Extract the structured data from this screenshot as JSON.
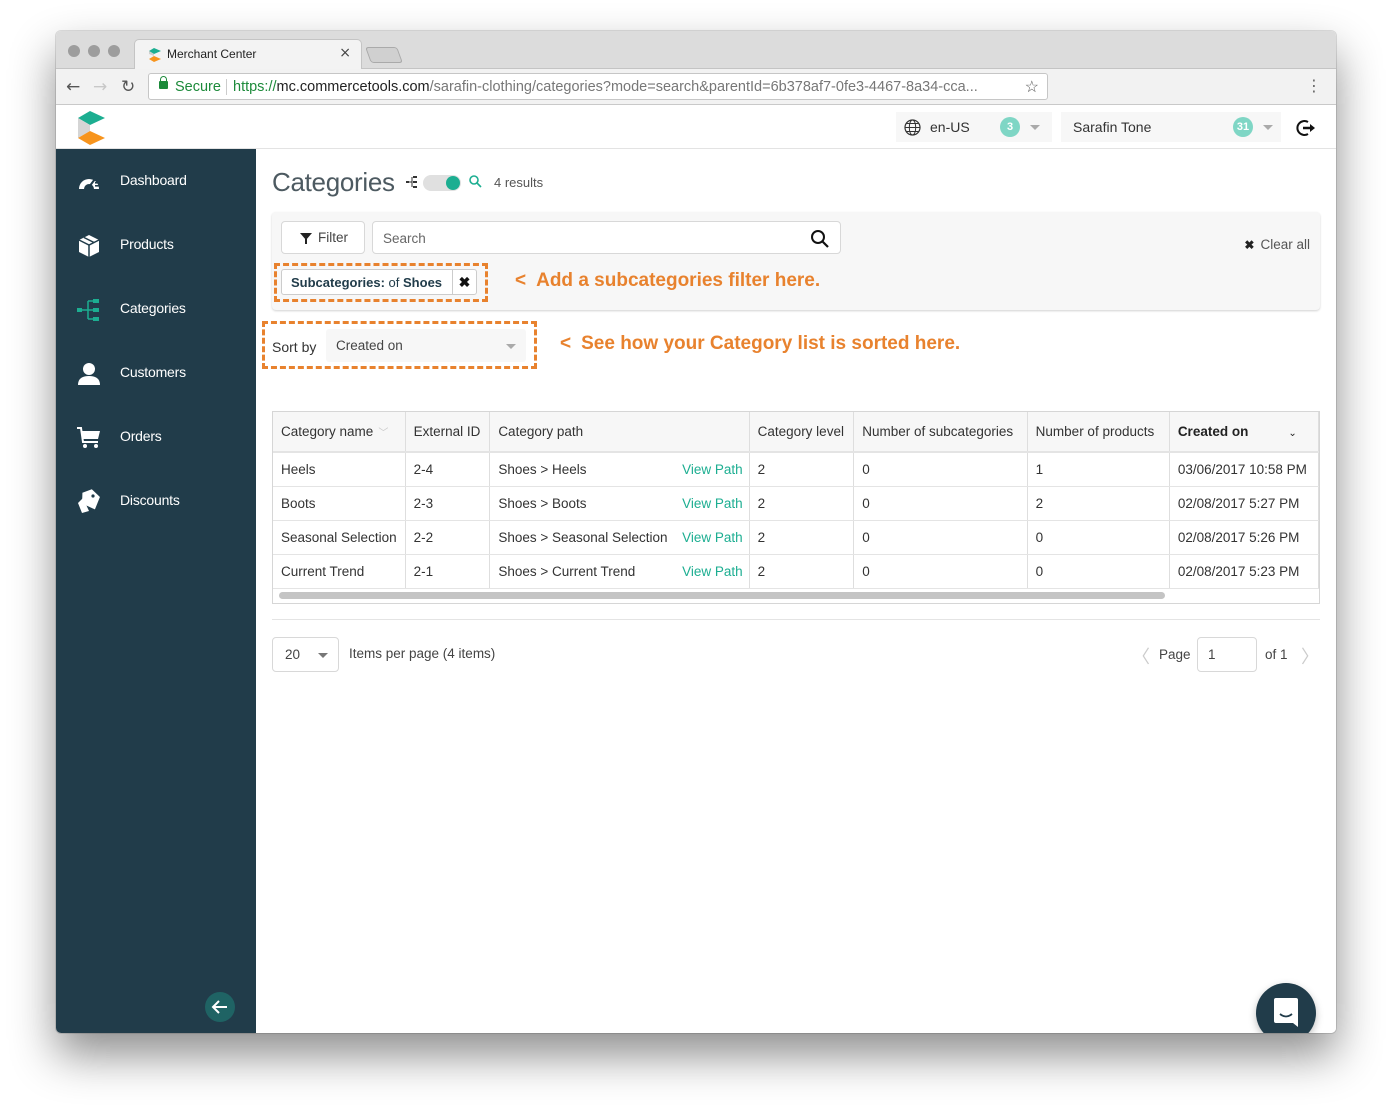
{
  "browser": {
    "tab_title": "Merchant Center",
    "secure_label": "Secure",
    "url_scheme": "https://",
    "url_host": "mc.commercetools.com",
    "url_path": "/sarafin-clothing/categories?mode=search&parentId=6b378af7-0fe3-4467-8a34-cca..."
  },
  "header": {
    "locale": "en-US",
    "locale_badge": "3",
    "user_name": "Sarafin Tone",
    "user_badge": "31",
    "badge_color": "#7fd6c5"
  },
  "sidebar": {
    "items": [
      {
        "label": "Dashboard",
        "icon": "dashboard-icon",
        "active": false
      },
      {
        "label": "Products",
        "icon": "box-icon",
        "active": false
      },
      {
        "label": "Categories",
        "icon": "category-tree-icon",
        "active": true
      },
      {
        "label": "Customers",
        "icon": "user-icon",
        "active": false
      },
      {
        "label": "Orders",
        "icon": "cart-icon",
        "active": false
      },
      {
        "label": "Discounts",
        "icon": "tag-icon",
        "active": false
      }
    ],
    "bg_color": "#213c4a",
    "accent_color": "#1cae91"
  },
  "page": {
    "title": "Categories",
    "results": "4 results",
    "filter_label": "Filter",
    "search_placeholder": "Search",
    "clear_all": "Clear all",
    "chip_key": "Subcategories:",
    "chip_mid": "of",
    "chip_value": "Shoes",
    "annotation_filter": "Add a subcategories filter here.",
    "annotation_sort": "See how your Category list is sorted here.",
    "annotation_marker": "<",
    "annotation_color": "#e8822e",
    "sort_label": "Sort by",
    "sort_value": "Created on"
  },
  "table": {
    "columns": [
      "Category name",
      "External ID",
      "Category path",
      "Category level",
      "Number of subcategories",
      "Number of products",
      "Created on"
    ],
    "view_path_label": "View Path",
    "rows": [
      {
        "name": "Heels",
        "external_id": "2-4",
        "path": "Shoes > Heels",
        "level": "2",
        "subcategories": "0",
        "products": "1",
        "created": "03/06/2017 10:58 PM"
      },
      {
        "name": "Boots",
        "external_id": "2-3",
        "path": "Shoes > Boots",
        "level": "2",
        "subcategories": "0",
        "products": "2",
        "created": "02/08/2017 5:27 PM"
      },
      {
        "name": "Seasonal Selection",
        "external_id": "2-2",
        "path": "Shoes > Seasonal Selection",
        "level": "2",
        "subcategories": "0",
        "products": "0",
        "created": "02/08/2017 5:26 PM"
      },
      {
        "name": "Current Trend",
        "external_id": "2-1",
        "path": "Shoes > Current Trend",
        "level": "2",
        "subcategories": "0",
        "products": "0",
        "created": "02/08/2017 5:23 PM"
      }
    ]
  },
  "pagination": {
    "per_page": "20",
    "per_page_label": "Items per page (4 items)",
    "page_label": "Page",
    "current_page": "1",
    "of_label": "of 1"
  }
}
